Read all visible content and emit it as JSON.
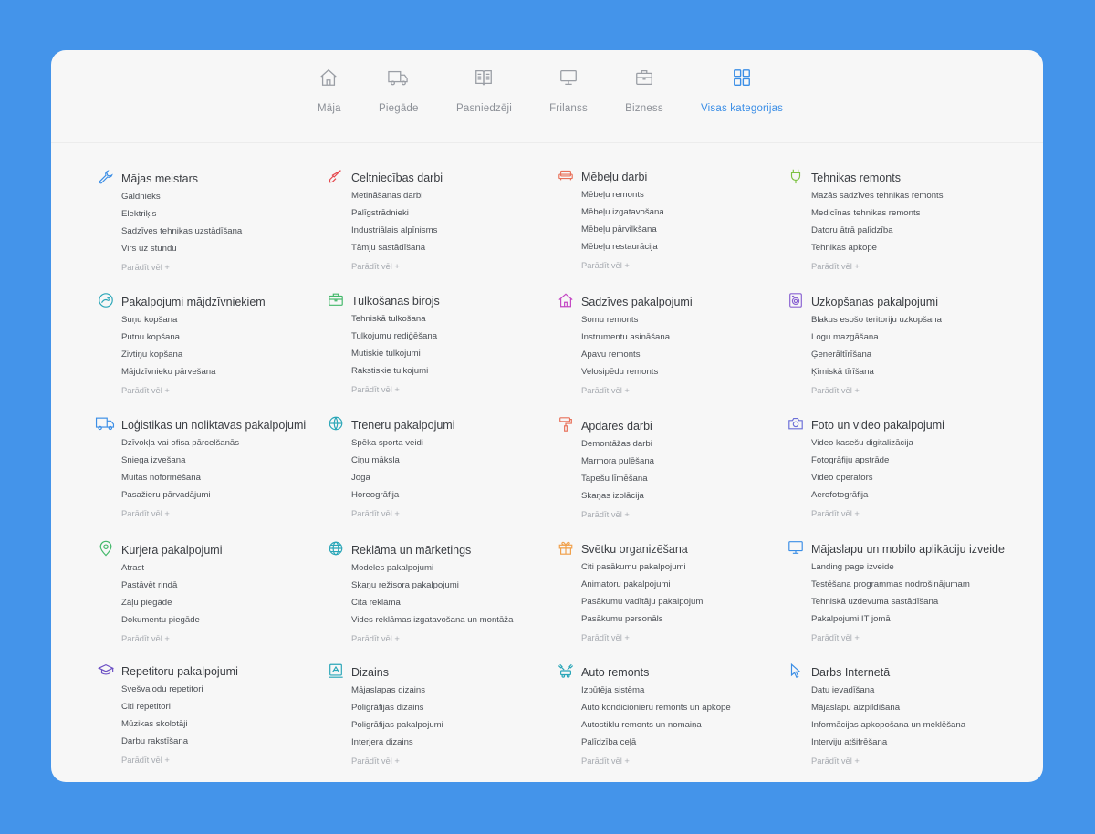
{
  "nav": {
    "items": [
      {
        "label": "Māja",
        "icon": "house-icon"
      },
      {
        "label": "Piegāde",
        "icon": "truck-icon"
      },
      {
        "label": "Pasniedzēji",
        "icon": "book-icon"
      },
      {
        "label": "Frilanss",
        "icon": "monitor-icon"
      },
      {
        "label": "Bizness",
        "icon": "briefcase-icon"
      },
      {
        "label": "Visas kategorijas",
        "icon": "grid-icon",
        "active": true
      }
    ]
  },
  "categories": [
    {
      "title": "Mājas meistars",
      "icon": "wrench-icon",
      "color": "#3b8ee6",
      "items": [
        "Galdnieks",
        "Elektriķis",
        "Sadzīves tehnikas uzstādīšana",
        "Virs uz stundu"
      ],
      "more": "Parādīt vēl +"
    },
    {
      "title": "Celtniecības darbi",
      "icon": "trowel-icon",
      "color": "#e5484d",
      "items": [
        "Metināšanas darbi",
        "Palīgstrādnieki",
        "Industriālais alpīnisms",
        "Tāmju sastādīšana"
      ],
      "more": "Parādīt vēl +"
    },
    {
      "title": "Mēbeļu darbi",
      "icon": "sofa-icon",
      "color": "#e8715a",
      "items": [
        "Mēbeļu remonts",
        "Mēbeļu izgatavošana",
        "Mēbeļu pārvilkšana",
        "Mēbeļu restaurācija"
      ],
      "more": "Parādīt vēl +"
    },
    {
      "title": "Tehnikas remonts",
      "icon": "plug-icon",
      "color": "#7cc242",
      "items": [
        "Mazās sadzīves tehnikas remonts",
        "Medicīnas tehnikas remonts",
        "Datoru ātrā palīdzība",
        "Tehnikas apkope"
      ],
      "more": "Parādīt vēl +"
    },
    {
      "title": "Pakalpojumi mājdzīvniekiem",
      "icon": "pet-icon",
      "color": "#2aa6b8",
      "items": [
        "Suņu kopšana",
        "Putnu kopšana",
        "Zivtiņu kopšana",
        "Mājdzīvnieku pārvešana"
      ],
      "more": "Parādīt vēl +"
    },
    {
      "title": "Tulkošanas birojs",
      "icon": "briefcase-icon",
      "color": "#43b86a",
      "items": [
        "Tehniskā tulkošana",
        "Tulkojumu rediģēšana",
        "Mutiskie tulkojumi",
        "Rakstiskie tulkojumi"
      ],
      "more": "Parādīt vēl +"
    },
    {
      "title": "Sadzīves pakalpojumi",
      "icon": "home-icon",
      "color": "#c447c4",
      "items": [
        "Somu remonts",
        "Instrumentu asināšana",
        "Apavu remonts",
        "Velosipēdu remonts"
      ],
      "more": "Parādīt vēl +"
    },
    {
      "title": "Uzkopšanas pakalpojumi",
      "icon": "washer-icon",
      "color": "#8a63d2",
      "items": [
        "Blakus esošo teritoriju uzkopšana",
        "Logu mazgāšana",
        "Ģenerāltīrīšana",
        "Ķīmiskā tīrīšana"
      ],
      "more": "Parādīt vēl +"
    },
    {
      "title": "Loģistikas un noliktavas pakalpojumi",
      "icon": "truck-icon",
      "color": "#3b8ee6",
      "items": [
        "Dzīvokļa vai ofisa pārcelšanās",
        "Sniega izvešana",
        "Muitas noformēšana",
        "Pasažieru pārvadājumi"
      ],
      "more": "Parādīt vēl +"
    },
    {
      "title": "Treneru pakalpojumi",
      "icon": "ball-icon",
      "color": "#2aa6b8",
      "items": [
        "Spēka sporta veidi",
        "Ciņu māksla",
        "Joga",
        "Horeogrāfija"
      ],
      "more": "Parādīt vēl +"
    },
    {
      "title": "Apdares darbi",
      "icon": "paint-roller-icon",
      "color": "#e8715a",
      "items": [
        "Demontāžas darbi",
        "Marmora pulēšana",
        "Tapešu līmēšana",
        "Skaņas izolācija"
      ],
      "more": "Parādīt vēl +"
    },
    {
      "title": "Foto un video pakalpojumi",
      "icon": "camera-icon",
      "color": "#6b6fd8",
      "items": [
        "Video kasešu digitalizācija",
        "Fotogrāfiju apstrāde",
        "Video operators",
        "Aerofotogrāfija"
      ],
      "more": "Parādīt vēl +"
    },
    {
      "title": "Kurjera pakalpojumi",
      "icon": "map-pin-icon",
      "color": "#43b86a",
      "items": [
        "Atrast",
        "Pastāvēt rindā",
        "Zāļu piegāde",
        "Dokumentu piegāde"
      ],
      "more": "Parādīt vēl +"
    },
    {
      "title": "Reklāma un mārketings",
      "icon": "globe-icon",
      "color": "#2aa6b8",
      "items": [
        "Modeles pakalpojumi",
        "Skaņu režisora pakalpojumi",
        "Cita reklāma",
        "Vides reklāmas izgatavošana un montāža"
      ],
      "more": "Parādīt vēl +"
    },
    {
      "title": "Svētku organizēšana",
      "icon": "gift-icon",
      "color": "#f0a04b",
      "items": [
        "Citi pasākumu pakalpojumi",
        "Animatoru pakalpojumi",
        "Pasākumu vadītāju pakalpojumi",
        "Pasākumu personāls"
      ],
      "more": "Parādīt vēl +"
    },
    {
      "title": "Mājaslapu un mobilo aplikāciju izveide",
      "icon": "monitor-icon",
      "color": "#3b8ee6",
      "items": [
        "Landing page izveide",
        "Testēšana programmas nodrošinājumam",
        "Tehniskā uzdevuma sastādīšana",
        "Pakalpojumi IT jomā"
      ],
      "more": "Parādīt vēl +"
    },
    {
      "title": "Repetitoru pakalpojumi",
      "icon": "graduation-cap-icon",
      "color": "#6b4fc4",
      "items": [
        "Svešvalodu repetitori",
        "Citi repetitori",
        "Mūzikas skolotāji",
        "Darbu rakstīšana"
      ],
      "more": "Parādīt vēl +"
    },
    {
      "title": "Dizains",
      "icon": "design-icon",
      "color": "#2aa6b8",
      "items": [
        "Mājaslapas dizains",
        "Poligrāfijas dizains",
        "Poligrāfijas pakalpojumi",
        "Interjera dizains"
      ],
      "more": "Parādīt vēl +"
    },
    {
      "title": "Auto remonts",
      "icon": "car-repair-icon",
      "color": "#2aa6b8",
      "items": [
        "Izpūtēja sistēma",
        "Auto kondicionieru remonts un apkope",
        "Autostiklu remonts un nomaiņa",
        "Palīdzība ceļā"
      ],
      "more": "Parādīt vēl +"
    },
    {
      "title": "Darbs Internetā",
      "icon": "cursor-icon",
      "color": "#3b8ee6",
      "items": [
        "Datu ievadīšana",
        "Mājaslapu aizpildīšana",
        "Informācijas apkopošana un meklēšana",
        "Interviju atšifrēšana"
      ],
      "more": "Parādīt vēl +"
    }
  ]
}
